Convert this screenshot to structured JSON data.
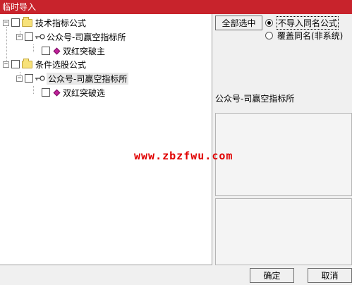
{
  "window": {
    "title": "临时导入"
  },
  "tree": {
    "groups": [
      {
        "label": "技术指标公式",
        "child": {
          "label": "公众号-司赢空指标所",
          "leaf": "双红突破主"
        }
      },
      {
        "label": "条件选股公式",
        "child": {
          "label": "公众号-司赢空指标所",
          "leaf": "双红突破选"
        }
      }
    ]
  },
  "options": {
    "select_all_label": "全部选中",
    "radio_skip_label": "不导入同名公式",
    "radio_overwrite_label": "覆盖同名(非系统)",
    "selected": "skip"
  },
  "info": {
    "label": "公众号-司赢空指标所"
  },
  "watermark": "www.zbzfwu.com",
  "footer": {
    "ok_label": "确定",
    "cancel_label": "取消"
  },
  "colors": {
    "titlebar": "#c8232c",
    "watermark": "#e00000",
    "item_icon": "#c0209a",
    "folder": "#f7e27a"
  }
}
